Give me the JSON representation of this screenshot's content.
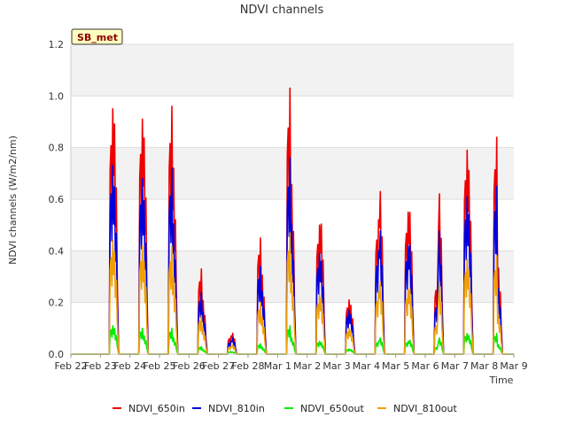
{
  "chart_data": {
    "type": "line",
    "title": "NDVI channels",
    "xlabel": "Time",
    "ylabel": "NDVI channels (W/m2/nm)",
    "ylim": [
      0.0,
      1.2
    ],
    "xlim": [
      0,
      15
    ],
    "grid": true,
    "legend_position": "bottom",
    "badge": "SB_met",
    "x_ticks": [
      {
        "x": 0,
        "label": "Feb 22"
      },
      {
        "x": 1,
        "label": "Feb 23"
      },
      {
        "x": 2,
        "label": "Feb 24"
      },
      {
        "x": 3,
        "label": "Feb 25"
      },
      {
        "x": 4,
        "label": "Feb 26"
      },
      {
        "x": 5,
        "label": "Feb 27"
      },
      {
        "x": 6,
        "label": "Feb 28"
      },
      {
        "x": 7,
        "label": "Mar 1"
      },
      {
        "x": 8,
        "label": "Mar 2"
      },
      {
        "x": 9,
        "label": "Mar 3"
      },
      {
        "x": 10,
        "label": "Mar 4"
      },
      {
        "x": 11,
        "label": "Mar 5"
      },
      {
        "x": 12,
        "label": "Mar 6"
      },
      {
        "x": 13,
        "label": "Mar 7"
      },
      {
        "x": 14,
        "label": "Mar 8"
      },
      {
        "x": 15,
        "label": "Mar 9"
      }
    ],
    "y_ticks": [
      "0.0",
      "0.2",
      "0.4",
      "0.6",
      "0.8",
      "1.0",
      "1.2"
    ],
    "series": [
      {
        "name": "NDVI_650in",
        "color": "#ee0000",
        "values": [
          0,
          0,
          0.95,
          0.99,
          0.91,
          0.93,
          0.96,
          0.8,
          0.33,
          0.23,
          0.07,
          0.09,
          0.45,
          0.34,
          1.03,
          0.73,
          0.5,
          0.56,
          0.21,
          0.21,
          0.52,
          0.7,
          0.55,
          0.61,
          0.29,
          0.69,
          0.79,
          0.79,
          0.84,
          0.37
        ]
      },
      {
        "name": "NDVI_810in",
        "color": "#0000dd",
        "values": [
          0,
          0,
          0.73,
          0.72,
          0.68,
          0.66,
          0.72,
          0.56,
          0.24,
          0.18,
          0.05,
          0.07,
          0.34,
          0.27,
          0.76,
          0.56,
          0.39,
          0.4,
          0.17,
          0.17,
          0.4,
          0.53,
          0.42,
          0.47,
          0.21,
          0.53,
          0.61,
          0.6,
          0.65,
          0.28
        ]
      },
      {
        "name": "NDVI_650out",
        "color": "#00ee00",
        "values": [
          0,
          0,
          0.11,
          0.11,
          0.1,
          0.08,
          0.1,
          0.07,
          0.03,
          0.02,
          0.01,
          0.01,
          0.04,
          0.03,
          0.11,
          0.07,
          0.05,
          0.05,
          0.02,
          0.02,
          0.05,
          0.07,
          0.05,
          0.06,
          0.03,
          0.07,
          0.08,
          0.08,
          0.08,
          0.04
        ]
      },
      {
        "name": "NDVI_810out",
        "color": "#f0a000",
        "values": [
          0,
          0,
          0.44,
          0.44,
          0.42,
          0.4,
          0.42,
          0.33,
          0.15,
          0.11,
          0.03,
          0.04,
          0.2,
          0.16,
          0.47,
          0.34,
          0.23,
          0.24,
          0.1,
          0.1,
          0.24,
          0.31,
          0.25,
          0.28,
          0.13,
          0.31,
          0.37,
          0.36,
          0.38,
          0.17
        ]
      }
    ]
  }
}
